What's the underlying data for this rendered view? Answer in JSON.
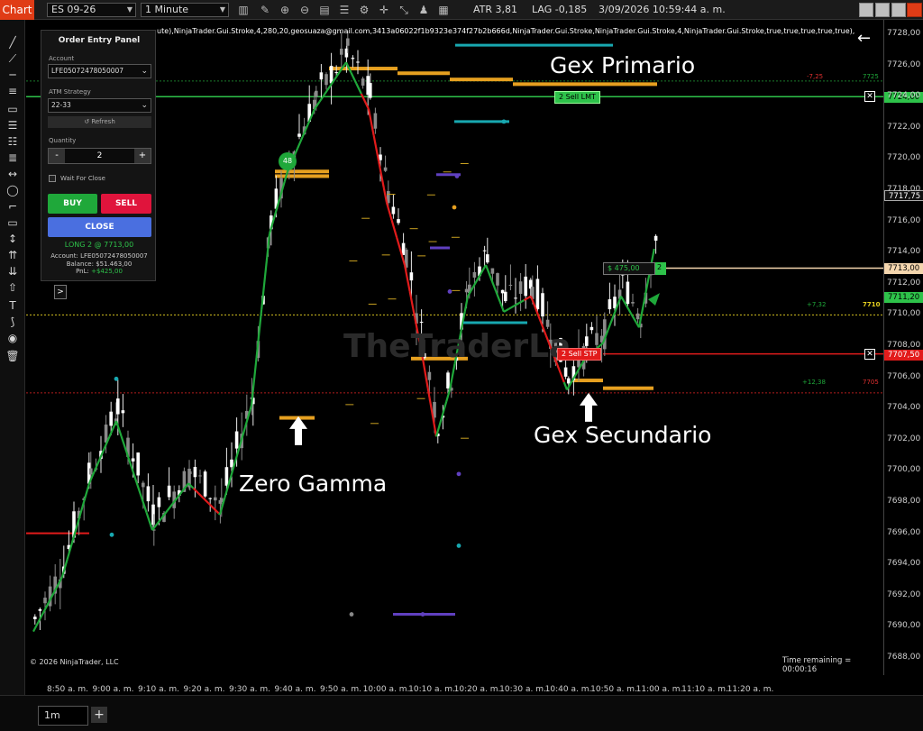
{
  "toolbar": {
    "chart_tab": "Chart",
    "instrument": "ES 09-26",
    "interval": "1 Minute",
    "atr": "ATR 3,81",
    "lag": "LAG -0,185",
    "datetime": "3/09/2026 10:59:44 a. m."
  },
  "chart": {
    "indicator_line": "ute),NinjaTrader.Gui.Stroke,4,280,20,geosuaza@gmail.com,3413a06022f1b9323e374f27b2b666d,NinjaTrader.Gui.Stroke,NinjaTrader.Gui.Stroke,4,NinjaTrader.Gui.Stroke,true,true,true,true,true),",
    "watermark": "TheTraderLa",
    "copyright": "© 2026 NinjaTrader, LLC",
    "time_remaining": "Time remaining = 00:00:16",
    "circle_badge": "48",
    "annotations": {
      "gex_primario": "Gex Primario",
      "gex_secundario": "Gex Secundario",
      "zero_gamma": "Zero Gamma"
    },
    "small_labels": {
      "r7725_left": "-7,25",
      "r7725": "7725",
      "r7710_left": "+7,32",
      "r7710": "7710",
      "r7705_left": "+12,38",
      "r7705": "7705"
    }
  },
  "orders": {
    "sell_lmt": {
      "qty": "2",
      "label": "Sell LMT",
      "price": "7724,00"
    },
    "sell_stp": {
      "qty": "2",
      "label": "Sell STP",
      "price": "7707,50"
    },
    "position": {
      "pnl": "$ 475,00",
      "qty": "2",
      "price": "7713,00"
    }
  },
  "price_axis": {
    "ticks": [
      "7728,00",
      "7726,00",
      "7724,00",
      "7722,00",
      "7720,00",
      "7718,00",
      "7716,00",
      "7714,00",
      "7712,00",
      "7710,00",
      "7708,00",
      "7706,00",
      "7704,00",
      "7702,00",
      "7700,00",
      "7698,00",
      "7696,00",
      "7694,00",
      "7692,00",
      "7690,00",
      "7688,00"
    ],
    "last_price": "7717,75",
    "green_price": "7711,20"
  },
  "time_axis": {
    "ticks": [
      "8:50 a. m.",
      "9:00 a. m.",
      "9:10 a. m.",
      "9:20 a. m.",
      "9:30 a. m.",
      "9:40 a. m.",
      "9:50 a. m.",
      "10:00 a. m.",
      "10:10 a. m.",
      "10:20 a. m.",
      "10:30 a. m.",
      "10:40 a. m.",
      "10:50 a. m.",
      "11:00 a. m.",
      "11:10 a. m.",
      "11:20 a. m."
    ]
  },
  "order_entry": {
    "title": "Order Entry Panel",
    "account_label": "Account",
    "account": "LFE05072478050007",
    "atm_label": "ATM Strategy",
    "atm": "22-33",
    "refresh": "↺ Refresh",
    "quantity_label": "Quantity",
    "quantity": "2",
    "minus": "-",
    "plus": "+",
    "wait_for_close": "Wait For Close",
    "buy": "BUY",
    "sell": "SELL",
    "close": "CLOSE",
    "position": "LONG  2 @ 7713,00",
    "account_line": "Account: LFE05072478050007",
    "balance_label": "Balance:",
    "balance": "$51.463,00",
    "pnl_label": "PnL:",
    "pnl": "+$425,00",
    "collapse": ">"
  },
  "bottom": {
    "tab": "1m",
    "add": "+"
  },
  "colors": {
    "chart_tab": "#e03c16",
    "gex_orange": "#e6a020",
    "bull_line": "#1fa83a",
    "bear_line": "#e21b1b",
    "buy": "#1fa83a",
    "sell": "#e0143c",
    "close": "#4a6fe0"
  }
}
